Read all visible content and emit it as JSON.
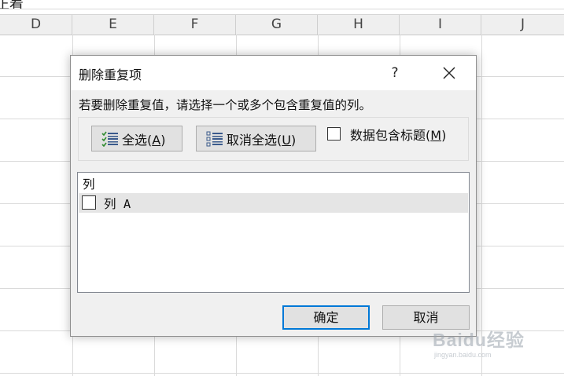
{
  "sheet": {
    "formula_text_fragment": "正着",
    "columns": [
      "D",
      "E",
      "F",
      "G",
      "H",
      "I",
      "J"
    ]
  },
  "dialog": {
    "title": "删除重复项",
    "help_label": "?",
    "instruction": "若要删除重复值，请选择一个或多个包含重复值的列。",
    "select_all": {
      "text": "全选(",
      "key": "A",
      "close": ")"
    },
    "deselect_all": {
      "text": "取消全选(",
      "key": "U",
      "close": ")"
    },
    "has_headers": {
      "text": "数据包含标题(",
      "key": "M",
      "close": ")",
      "checked": false
    },
    "columns_header": "列",
    "columns_list": [
      {
        "label": "列 A",
        "checked": false
      }
    ],
    "ok_label": "确定",
    "cancel_label": "取消"
  },
  "watermark": {
    "main": "Baidu经验",
    "sub": "jingyan.baidu.com"
  },
  "colors": {
    "dialog_bg": "#f0f0f0",
    "button_bg": "#e1e1e1",
    "focus_border": "#0078d7",
    "selected_row": "#e5e5e5",
    "select_icon_green": "#2e8b2e"
  },
  "icons": {
    "select_all": "select-all-list-icon",
    "deselect_all": "deselect-all-list-icon",
    "close": "close-icon"
  }
}
